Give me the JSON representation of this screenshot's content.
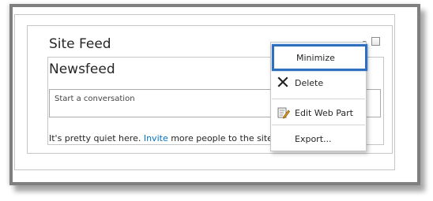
{
  "webpart": {
    "title": "Site Feed",
    "menu_arrow": "▾"
  },
  "newsfeed": {
    "title": "Newsfeed",
    "input_placeholder": "Start a conversation",
    "quiet_prefix": "It's pretty quiet here. ",
    "invite_link": "Invite",
    "quiet_suffix": " more people to the site, or start a conversation."
  },
  "menu": {
    "items": [
      {
        "label": "Minimize",
        "icon": ""
      },
      {
        "label": "Delete",
        "icon": "close-icon"
      },
      {
        "label": "Edit Web Part",
        "icon": "edit-icon"
      },
      {
        "label": "Export...",
        "icon": ""
      }
    ],
    "highlight_color": "#2f6fbf"
  }
}
